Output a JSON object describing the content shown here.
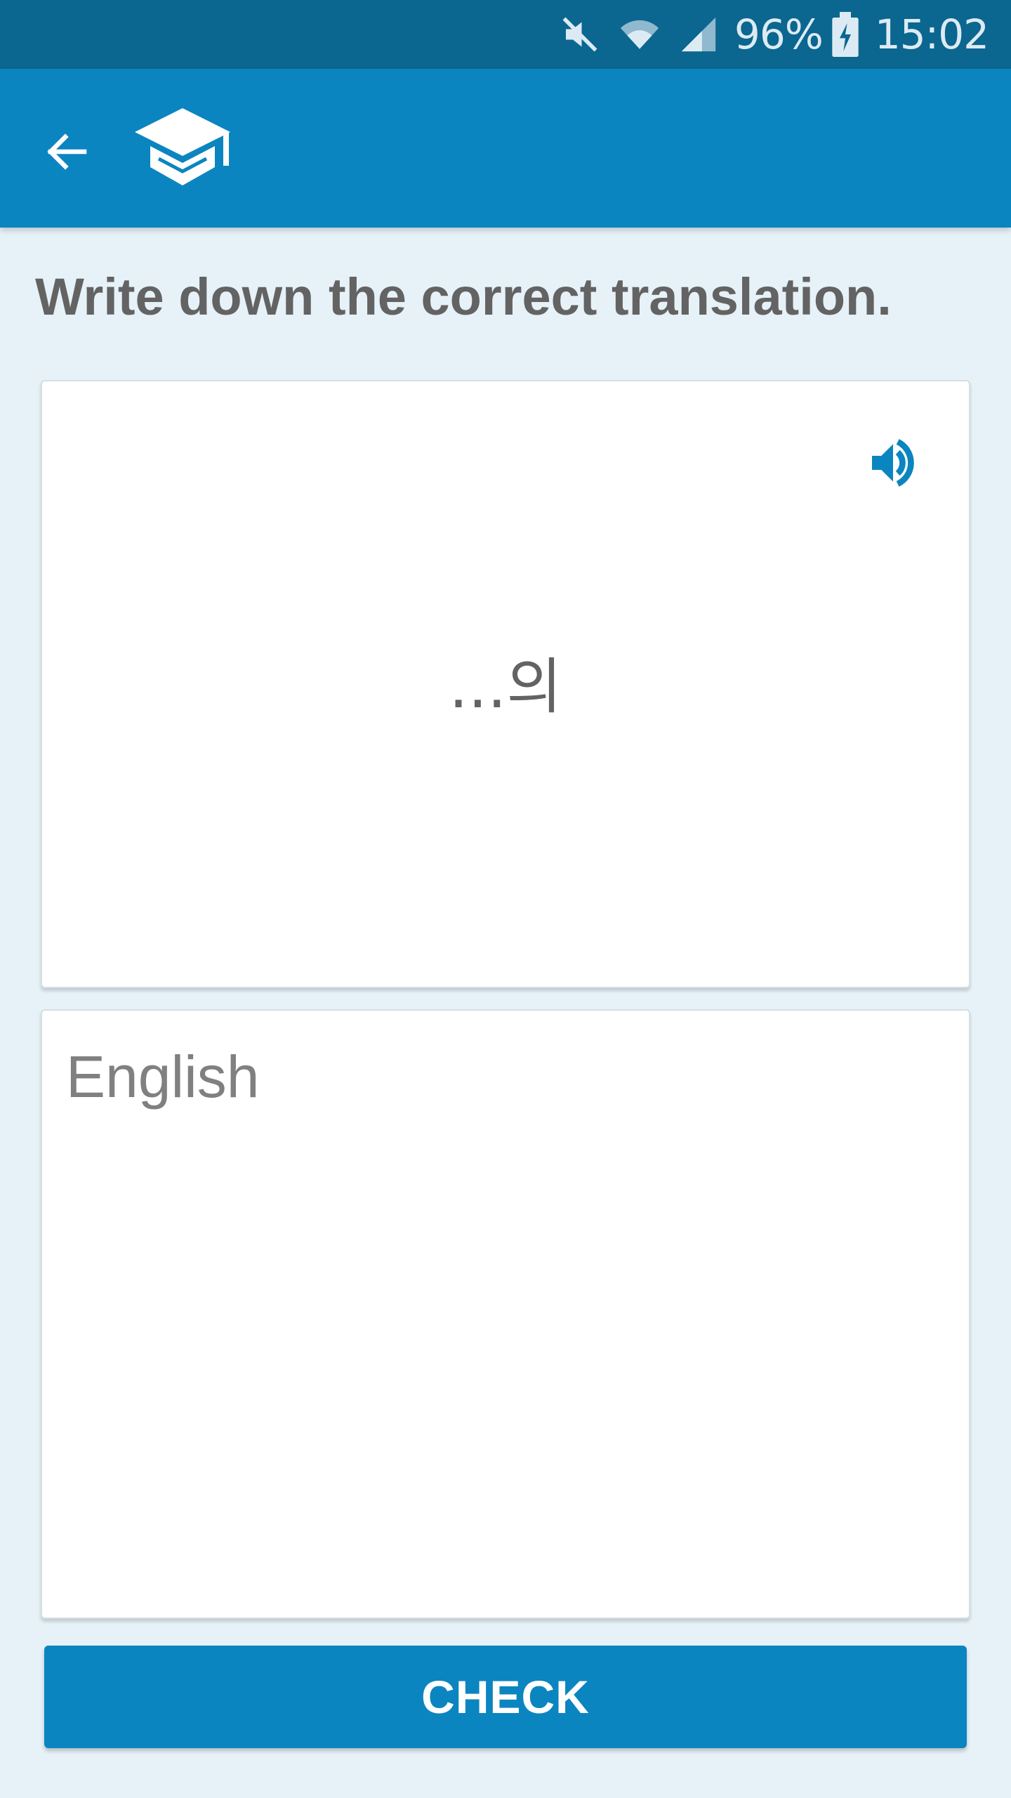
{
  "status_bar": {
    "battery": "96%",
    "time": "15:02",
    "icons": [
      "mute-icon",
      "wifi-icon",
      "signal-icon",
      "battery-charging-icon"
    ]
  },
  "app_bar": {
    "back_icon": "arrow-left-icon",
    "logo_icon": "graduation-cap-icon",
    "color": "#0B85C0"
  },
  "exercise": {
    "instruction": "Write down the correct translation.",
    "prompt_word": "...의",
    "audio_icon": "speaker-icon",
    "answer_placeholder": "English",
    "answer_value": ""
  },
  "actions": {
    "check_label": "CHECK"
  },
  "colors": {
    "status_bar": "#0B6690",
    "primary": "#0B85C0",
    "background": "#E6F2F8",
    "text": "#636363"
  }
}
